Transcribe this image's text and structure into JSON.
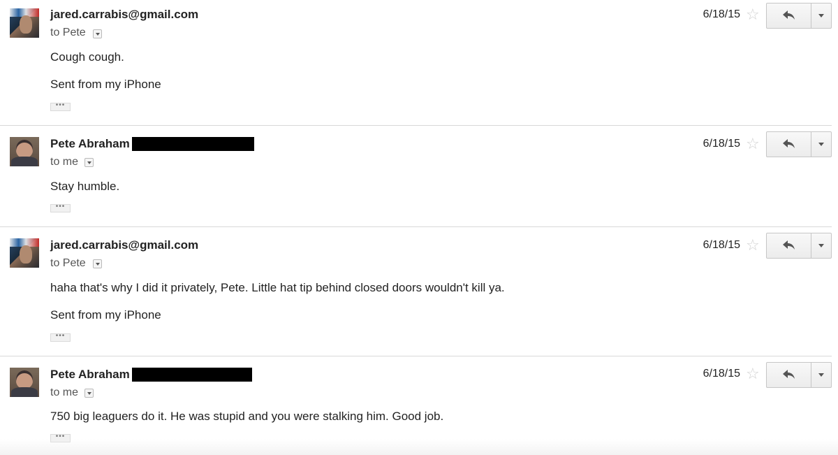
{
  "messages": [
    {
      "sender": "jared.carrabis@gmail.com",
      "recipient": "to Pete",
      "date": "6/18/15",
      "body": [
        "Cough cough.",
        "Sent from my iPhone"
      ],
      "avatar": "jared-avatar"
    },
    {
      "sender": "Pete Abraham",
      "recipient": "to me",
      "date": "6/18/15",
      "body": [
        "Stay humble."
      ],
      "avatar": "pete-avatar"
    },
    {
      "sender": "jared.carrabis@gmail.com",
      "recipient": "to Pete",
      "date": "6/18/15",
      "body": [
        "haha that's why I did it privately, Pete. Little hat tip behind closed doors wouldn't kill ya.",
        "Sent from my iPhone"
      ],
      "avatar": "jared-avatar"
    },
    {
      "sender": "Pete Abraham",
      "recipient": "to me",
      "date": "6/18/15",
      "body": [
        "750 big leaguers do it. He was stupid and you were stalking him. Good job."
      ],
      "avatar": "pete-avatar"
    }
  ],
  "icons": {
    "star": "star-icon",
    "reply": "reply-icon",
    "more": "chevron-down-icon",
    "trimmed": "ellipsis-icon"
  },
  "colors": {
    "divider": "#d8d8d8",
    "button_border": "#c6c6c6",
    "star": "#d0d0d0"
  }
}
